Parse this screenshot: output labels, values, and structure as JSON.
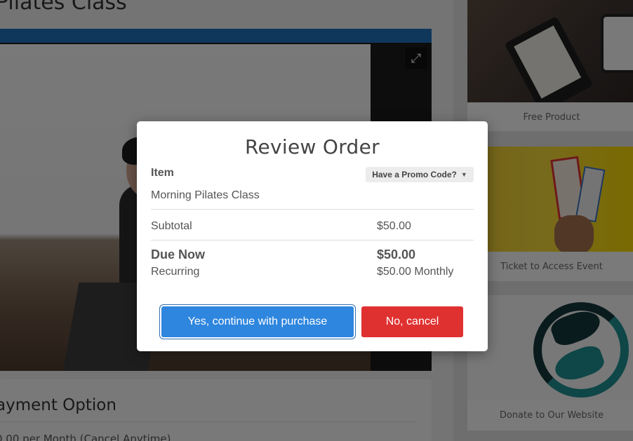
{
  "background": {
    "page_title": "Pilates Class",
    "payment_section": {
      "title": "ayment Option",
      "line": "0.00 per Month (Cancel Anytime)"
    },
    "sidebar": {
      "cards": [
        {
          "label": "Free Product"
        },
        {
          "label": "Ticket to Access Event"
        },
        {
          "label": "Donate to Our Website"
        }
      ]
    },
    "video": {
      "expand_icon": "expand-icon"
    }
  },
  "modal": {
    "title": "Review Order",
    "item_header": "Item",
    "promo_button": "Have a Promo Code?",
    "item_name": "Morning Pilates Class",
    "subtotal_label": "Subtotal",
    "subtotal_value": "$50.00",
    "due_now_label": "Due Now",
    "due_now_value": "$50.00",
    "recurring_label": "Recurring",
    "recurring_value": "$50.00 Monthly",
    "confirm_button": "Yes, continue with purchase",
    "cancel_button": "No, cancel"
  },
  "colors": {
    "confirm": "#2e86de",
    "cancel": "#e03131",
    "video_bar": "#1e6fb8"
  }
}
